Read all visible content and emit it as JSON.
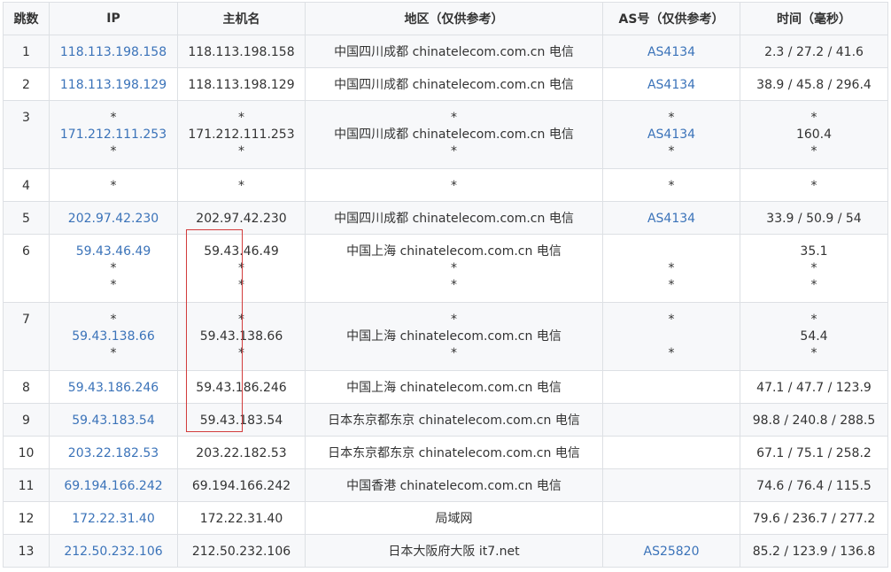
{
  "headers": {
    "hop": "跳数",
    "ip": "IP",
    "hostname": "主机名",
    "region": "地区（仅供参考）",
    "asn": "AS号（仅供参考）",
    "time": "时间（毫秒）"
  },
  "rows": [
    {
      "hop": "1",
      "ip": [
        "118.113.198.158"
      ],
      "host": [
        "118.113.198.158"
      ],
      "region": [
        "中国四川成都 chinatelecom.com.cn 电信"
      ],
      "asn": [
        "AS4134"
      ],
      "time": [
        "2.3 / 27.2 / 41.6"
      ]
    },
    {
      "hop": "2",
      "ip": [
        "118.113.198.129"
      ],
      "host": [
        "118.113.198.129"
      ],
      "region": [
        "中国四川成都 chinatelecom.com.cn 电信"
      ],
      "asn": [
        "AS4134"
      ],
      "time": [
        "38.9 / 45.8 / 296.4"
      ]
    },
    {
      "hop": "3",
      "ip": [
        "*",
        "171.212.111.253",
        "*"
      ],
      "host": [
        "*",
        "171.212.111.253",
        "*"
      ],
      "region": [
        "*",
        "中国四川成都 chinatelecom.com.cn 电信",
        "*"
      ],
      "asn": [
        "*",
        "AS4134",
        "*"
      ],
      "time": [
        "*",
        "160.4",
        "*"
      ]
    },
    {
      "hop": "4",
      "ip": [
        "*"
      ],
      "host": [
        "*"
      ],
      "region": [
        "*"
      ],
      "asn": [
        "*"
      ],
      "time": [
        "*"
      ]
    },
    {
      "hop": "5",
      "ip": [
        "202.97.42.230"
      ],
      "host": [
        "202.97.42.230"
      ],
      "region": [
        "中国四川成都 chinatelecom.com.cn 电信"
      ],
      "asn": [
        "AS4134"
      ],
      "time": [
        "33.9 / 50.9 / 54"
      ]
    },
    {
      "hop": "6",
      "ip": [
        "59.43.46.49",
        "*",
        "*"
      ],
      "host": [
        "59.43.46.49",
        "*",
        "*"
      ],
      "region": [
        "中国上海 chinatelecom.com.cn 电信",
        "*",
        "*"
      ],
      "asn": [
        "",
        "*",
        "*"
      ],
      "time": [
        "35.1",
        "*",
        "*"
      ]
    },
    {
      "hop": "7",
      "ip": [
        "*",
        "59.43.138.66",
        "*"
      ],
      "host": [
        "*",
        "59.43.138.66",
        "*"
      ],
      "region": [
        "*",
        "中国上海 chinatelecom.com.cn 电信",
        "*"
      ],
      "asn": [
        "*",
        "",
        "*"
      ],
      "time": [
        "*",
        "54.4",
        "*"
      ]
    },
    {
      "hop": "8",
      "ip": [
        "59.43.186.246"
      ],
      "host": [
        "59.43.186.246"
      ],
      "region": [
        "中国上海 chinatelecom.com.cn 电信"
      ],
      "asn": [
        ""
      ],
      "time": [
        "47.1 / 47.7 / 123.9"
      ]
    },
    {
      "hop": "9",
      "ip": [
        "59.43.183.54"
      ],
      "host": [
        "59.43.183.54"
      ],
      "region": [
        "日本东京都东京 chinatelecom.com.cn 电信"
      ],
      "asn": [
        ""
      ],
      "time": [
        "98.8 / 240.8 / 288.5"
      ]
    },
    {
      "hop": "10",
      "ip": [
        "203.22.182.53"
      ],
      "host": [
        "203.22.182.53"
      ],
      "region": [
        "日本东京都东京 chinatelecom.com.cn 电信"
      ],
      "asn": [
        ""
      ],
      "time": [
        "67.1 / 75.1 / 258.2"
      ]
    },
    {
      "hop": "11",
      "ip": [
        "69.194.166.242"
      ],
      "host": [
        "69.194.166.242"
      ],
      "region": [
        "中国香港 chinatelecom.com.cn 电信"
      ],
      "asn": [
        ""
      ],
      "time": [
        "74.6 / 76.4 / 115.5"
      ]
    },
    {
      "hop": "12",
      "ip": [
        "172.22.31.40"
      ],
      "host": [
        "172.22.31.40"
      ],
      "region": [
        "局域网"
      ],
      "asn": [
        ""
      ],
      "time": [
        "79.6 / 236.7 / 277.2"
      ]
    },
    {
      "hop": "13",
      "ip": [
        "212.50.232.106"
      ],
      "host": [
        "212.50.232.106"
      ],
      "region": [
        "日本大阪府大阪 it7.net"
      ],
      "asn": [
        "AS25820"
      ],
      "time": [
        "85.2 / 123.9 / 136.8"
      ]
    }
  ],
  "colors": {
    "link": "#3b73b9",
    "highlight_box": "#d23c3c",
    "stripe": "#f7f8fa",
    "border": "#dde0e4"
  }
}
